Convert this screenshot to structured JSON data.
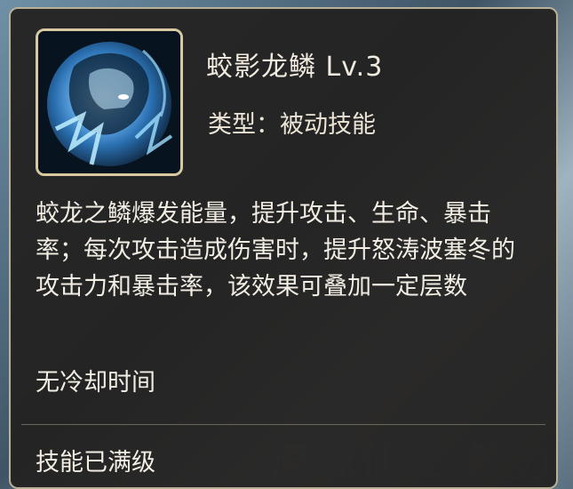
{
  "skill": {
    "name": "蛟影龙鳞 Lv.3",
    "type": "类型：被动技能",
    "description": "蛟龙之鳞爆发能量，提升攻击、生命、暴击率；每次攻击造成伤害时，提升怒涛波塞冬的攻击力和暴击率，该效果可叠加一定层数",
    "cooldown": "无冷却时间",
    "level_status": "技能已满级",
    "icon": "frost-dragon-hero-portrait-icon"
  },
  "colors": {
    "panel_bg": "#242221",
    "panel_border": "#b9b098",
    "icon_border": "#d9c9a3",
    "text": "#f3eee4"
  }
}
